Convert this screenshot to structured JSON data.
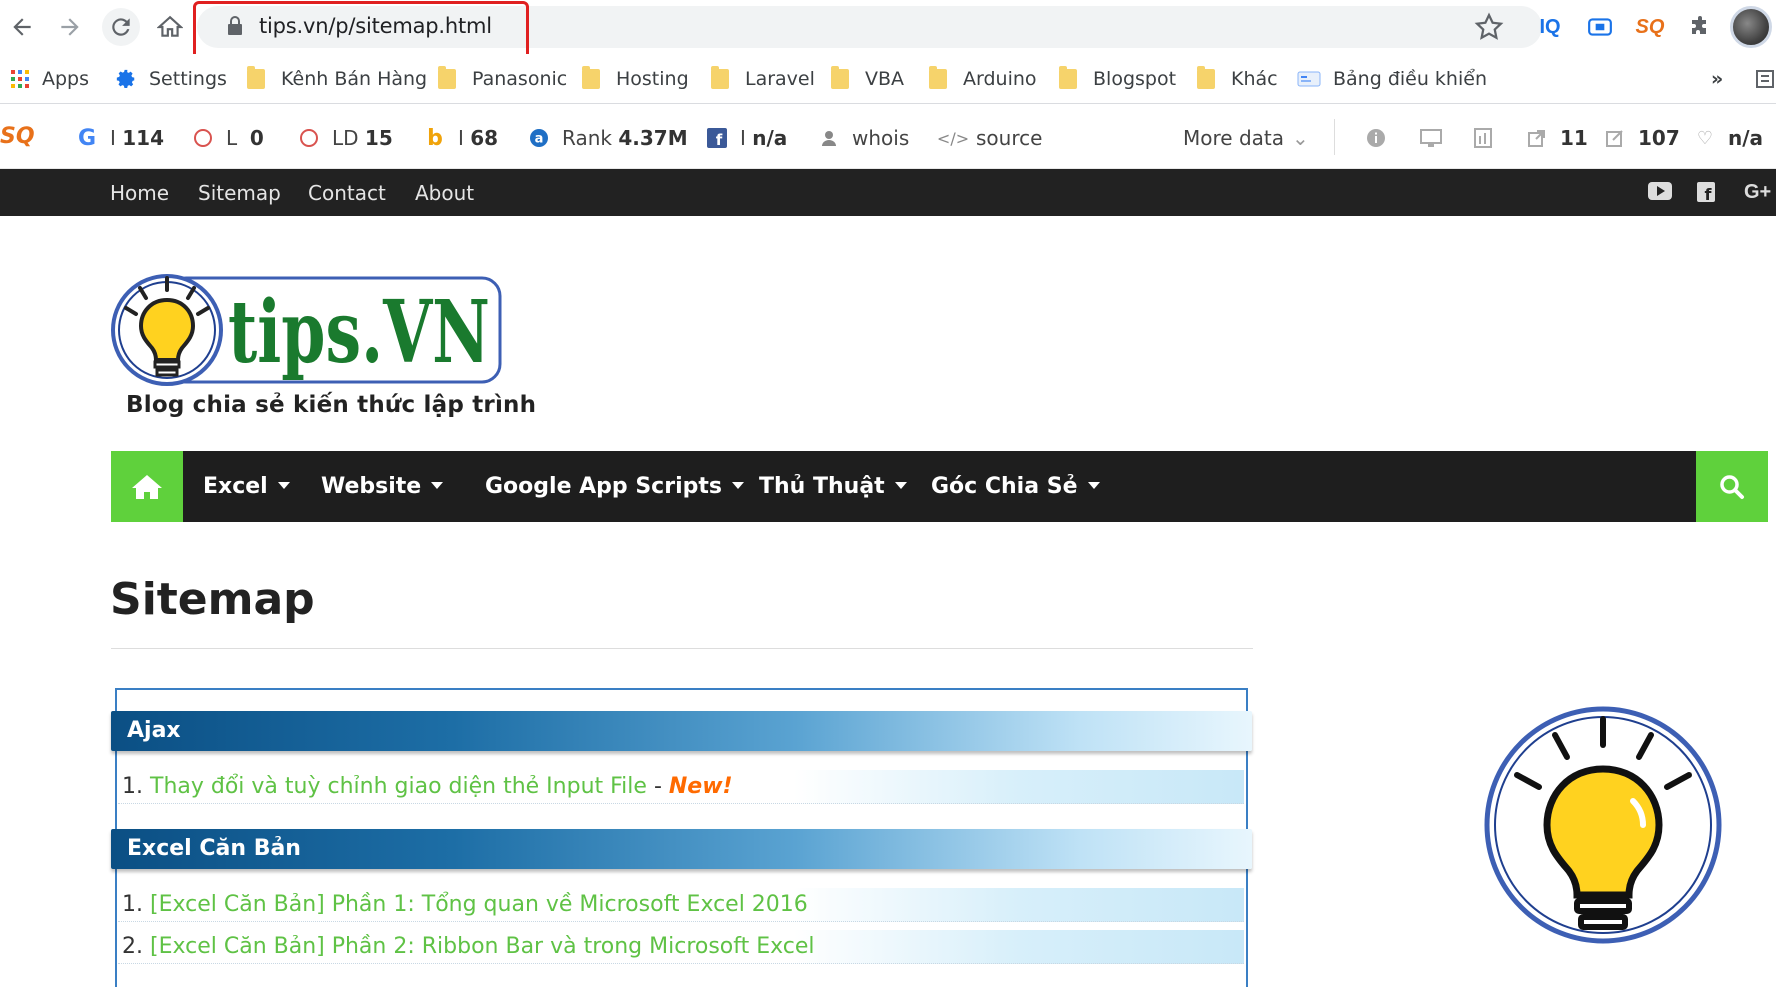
{
  "browser": {
    "url": "tips.vn/p/sitemap.html",
    "extensions": [
      "IQ",
      "SEO Quake",
      "puzzle"
    ]
  },
  "bookmarks": [
    {
      "label": "Apps",
      "icon": "apps-grid-icon"
    },
    {
      "label": "Settings",
      "icon": "gear-icon"
    },
    {
      "label": "Kênh Bán Hàng",
      "icon": "folder-icon"
    },
    {
      "label": "Panasonic",
      "icon": "folder-icon"
    },
    {
      "label": "Hosting",
      "icon": "folder-icon"
    },
    {
      "label": "Laravel",
      "icon": "folder-icon"
    },
    {
      "label": "VBA",
      "icon": "folder-icon"
    },
    {
      "label": "Arduino",
      "icon": "folder-icon"
    },
    {
      "label": "Blogspot",
      "icon": "folder-icon"
    },
    {
      "label": "Khác",
      "icon": "folder-icon"
    },
    {
      "label": "Bảng điều khiển",
      "icon": "dashboard-icon"
    }
  ],
  "bookmarks_more": "»",
  "seo": {
    "google_label": "I",
    "google_value": "114",
    "l_label": "L",
    "l_value": "0",
    "ld_label": "LD",
    "ld_value": "15",
    "bing_label": "I",
    "bing_value": "68",
    "rank_label": "Rank",
    "rank_value": "4.37M",
    "fb_label": "I",
    "fb_value": "n/a",
    "whois": "whois",
    "source": "source",
    "more_data": "More data",
    "ext_links": "11",
    "pages": "107",
    "health": "n/a"
  },
  "site_topnav": [
    "Home",
    "Sitemap",
    "Contact",
    "About"
  ],
  "site_social": {
    "youtube": "▶",
    "facebook": "f",
    "gplus": "G+"
  },
  "logo": {
    "text": "tips.VN",
    "tagline": "Blog chia sẻ kiến thức lập trình"
  },
  "main_menu": [
    "Excel",
    "Website",
    "Google App Scripts",
    "Thủ Thuật",
    "Góc Chia Sẻ"
  ],
  "page_title": "Sitemap",
  "sitemap": [
    {
      "category": "Ajax",
      "posts": [
        {
          "num": "1.",
          "title": "Thay đổi và tuỳ chỉnh giao diện thẻ Input File",
          "sep": " - ",
          "badge": "New!"
        }
      ]
    },
    {
      "category": "Excel Căn Bản",
      "posts": [
        {
          "num": "1.",
          "title": "[Excel Căn Bản] Phần 1: Tổng quan về Microsoft Excel 2016"
        },
        {
          "num": "2.",
          "title": "[Excel Căn Bản] Phần 2: Ribbon Bar và trong Microsoft Excel"
        }
      ]
    }
  ],
  "colors": {
    "accent_green": "#5fd13c",
    "link_green": "#5fc245",
    "header_blue": "#0b4f84",
    "new_badge": "#ff6a00",
    "highlight_red": "#e02020"
  }
}
